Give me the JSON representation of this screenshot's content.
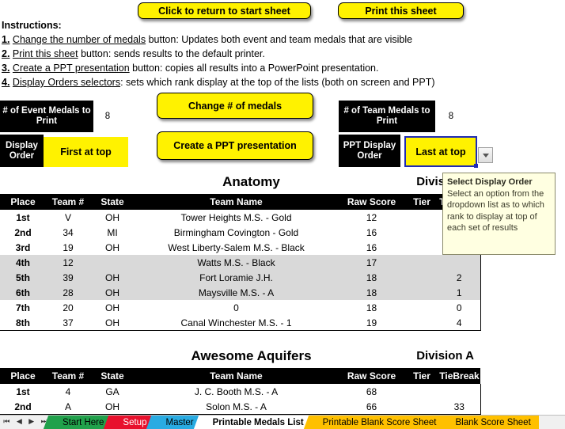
{
  "buttons": {
    "return_to_start": "Click to return to start sheet",
    "print_sheet": "Print this sheet",
    "change_medals": "Change # of medals",
    "create_ppt": "Create a PPT presentation"
  },
  "instructions": {
    "title": "Instructions:",
    "items": [
      {
        "num": "1.",
        "link": "Change the number of medals",
        "rest": " button: Updates both event and team medals that are visible"
      },
      {
        "num": "2.",
        "link": "Print this sheet",
        "rest": " button:  sends results to the default printer."
      },
      {
        "num": "3.",
        "link": "Create a PPT presentation",
        "rest": " button:  copies all results into a PowerPoint presentation."
      },
      {
        "num": "4.",
        "link": "Display Orders selectors",
        "rest": ": sets which rank display at the top of the lists (both on screen and PPT)"
      }
    ]
  },
  "controls": {
    "event_medals_label": "# of Event Medals to Print",
    "event_medals_value": "8",
    "display_order_label": "Display Order",
    "display_order_value": "First at top",
    "team_medals_label": "# of Team Medals to Print",
    "team_medals_value": "8",
    "ppt_display_order_label": "PPT Display Order",
    "ppt_display_order_value": "Last at top"
  },
  "tooltip": {
    "title": "Select Display Order",
    "body": "Select an option from the dropdown list as to which rank to display at top of each set of results"
  },
  "reports": [
    {
      "event": "Anatomy",
      "division": "Division A",
      "columns": [
        "Place",
        "Team #",
        "State",
        "Team Name",
        "Raw Score",
        "Tier",
        "TieBreak"
      ],
      "rows": [
        {
          "place": "1st",
          "team": "V",
          "state": "OH",
          "name": "Tower Heights M.S. - Gold",
          "raw": "12",
          "tier": "",
          "tiebreak": "",
          "selected": false
        },
        {
          "place": "2nd",
          "team": "34",
          "state": "MI",
          "name": "Birmingham Covington - Gold",
          "raw": "16",
          "tier": "",
          "tiebreak": "",
          "selected": false
        },
        {
          "place": "3rd",
          "team": "19",
          "state": "OH",
          "name": "West Liberty-Salem M.S. - Black",
          "raw": "16",
          "tier": "",
          "tiebreak": "",
          "selected": false
        },
        {
          "place": "4th",
          "team": "12",
          "state": "",
          "name": "Watts M.S. - Black",
          "raw": "17",
          "tier": "",
          "tiebreak": "",
          "selected": true
        },
        {
          "place": "5th",
          "team": "39",
          "state": "OH",
          "name": "Fort Loramie J.H.",
          "raw": "18",
          "tier": "",
          "tiebreak": "2",
          "selected": true
        },
        {
          "place": "6th",
          "team": "28",
          "state": "OH",
          "name": "Maysville M.S. - A",
          "raw": "18",
          "tier": "",
          "tiebreak": "1",
          "selected": true
        },
        {
          "place": "7th",
          "team": "20",
          "state": "OH",
          "name": "0",
          "raw": "18",
          "tier": "",
          "tiebreak": "0",
          "selected": false
        },
        {
          "place": "8th",
          "team": "37",
          "state": "OH",
          "name": "Canal Winchester M.S. - 1",
          "raw": "19",
          "tier": "",
          "tiebreak": "4",
          "selected": false
        }
      ]
    },
    {
      "event": "Awesome Aquifers",
      "division": "Division A",
      "columns": [
        "Place",
        "Team #",
        "State",
        "Team Name",
        "Raw Score",
        "Tier",
        "TieBreak"
      ],
      "rows": [
        {
          "place": "1st",
          "team": "4",
          "state": "GA",
          "name": "J. C. Booth M.S. - A",
          "raw": "68",
          "tier": "",
          "tiebreak": "",
          "selected": false
        },
        {
          "place": "2nd",
          "team": "A",
          "state": "OH",
          "name": "Solon M.S. - A",
          "raw": "66",
          "tier": "",
          "tiebreak": "33",
          "selected": false
        }
      ]
    }
  ],
  "sheet_tabs": {
    "nav": [
      "⏮",
      "◀",
      "▶",
      "⏭"
    ],
    "tabs": [
      {
        "label": "Start Here",
        "color": "green",
        "active": false
      },
      {
        "label": "Setup",
        "color": "red",
        "active": false
      },
      {
        "label": "Master",
        "color": "blue",
        "active": false
      },
      {
        "label": "Printable Medals List",
        "color": "white",
        "active": true
      },
      {
        "label": "Printable Blank Score Sheet",
        "color": "orange",
        "active": false
      },
      {
        "label": "Blank Score Sheet",
        "color": "orange",
        "active": false
      }
    ]
  }
}
